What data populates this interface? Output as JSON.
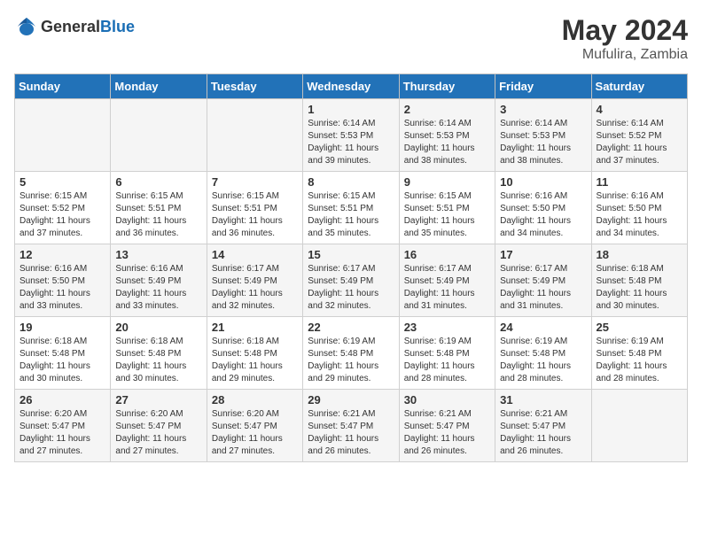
{
  "header": {
    "logo_general": "General",
    "logo_blue": "Blue",
    "month_year": "May 2024",
    "location": "Mufulira, Zambia"
  },
  "days_of_week": [
    "Sunday",
    "Monday",
    "Tuesday",
    "Wednesday",
    "Thursday",
    "Friday",
    "Saturday"
  ],
  "weeks": [
    [
      {
        "day": "",
        "info": ""
      },
      {
        "day": "",
        "info": ""
      },
      {
        "day": "",
        "info": ""
      },
      {
        "day": "1",
        "info": "Sunrise: 6:14 AM\nSunset: 5:53 PM\nDaylight: 11 hours\nand 39 minutes."
      },
      {
        "day": "2",
        "info": "Sunrise: 6:14 AM\nSunset: 5:53 PM\nDaylight: 11 hours\nand 38 minutes."
      },
      {
        "day": "3",
        "info": "Sunrise: 6:14 AM\nSunset: 5:53 PM\nDaylight: 11 hours\nand 38 minutes."
      },
      {
        "day": "4",
        "info": "Sunrise: 6:14 AM\nSunset: 5:52 PM\nDaylight: 11 hours\nand 37 minutes."
      }
    ],
    [
      {
        "day": "5",
        "info": "Sunrise: 6:15 AM\nSunset: 5:52 PM\nDaylight: 11 hours\nand 37 minutes."
      },
      {
        "day": "6",
        "info": "Sunrise: 6:15 AM\nSunset: 5:51 PM\nDaylight: 11 hours\nand 36 minutes."
      },
      {
        "day": "7",
        "info": "Sunrise: 6:15 AM\nSunset: 5:51 PM\nDaylight: 11 hours\nand 36 minutes."
      },
      {
        "day": "8",
        "info": "Sunrise: 6:15 AM\nSunset: 5:51 PM\nDaylight: 11 hours\nand 35 minutes."
      },
      {
        "day": "9",
        "info": "Sunrise: 6:15 AM\nSunset: 5:51 PM\nDaylight: 11 hours\nand 35 minutes."
      },
      {
        "day": "10",
        "info": "Sunrise: 6:16 AM\nSunset: 5:50 PM\nDaylight: 11 hours\nand 34 minutes."
      },
      {
        "day": "11",
        "info": "Sunrise: 6:16 AM\nSunset: 5:50 PM\nDaylight: 11 hours\nand 34 minutes."
      }
    ],
    [
      {
        "day": "12",
        "info": "Sunrise: 6:16 AM\nSunset: 5:50 PM\nDaylight: 11 hours\nand 33 minutes."
      },
      {
        "day": "13",
        "info": "Sunrise: 6:16 AM\nSunset: 5:49 PM\nDaylight: 11 hours\nand 33 minutes."
      },
      {
        "day": "14",
        "info": "Sunrise: 6:17 AM\nSunset: 5:49 PM\nDaylight: 11 hours\nand 32 minutes."
      },
      {
        "day": "15",
        "info": "Sunrise: 6:17 AM\nSunset: 5:49 PM\nDaylight: 11 hours\nand 32 minutes."
      },
      {
        "day": "16",
        "info": "Sunrise: 6:17 AM\nSunset: 5:49 PM\nDaylight: 11 hours\nand 31 minutes."
      },
      {
        "day": "17",
        "info": "Sunrise: 6:17 AM\nSunset: 5:49 PM\nDaylight: 11 hours\nand 31 minutes."
      },
      {
        "day": "18",
        "info": "Sunrise: 6:18 AM\nSunset: 5:48 PM\nDaylight: 11 hours\nand 30 minutes."
      }
    ],
    [
      {
        "day": "19",
        "info": "Sunrise: 6:18 AM\nSunset: 5:48 PM\nDaylight: 11 hours\nand 30 minutes."
      },
      {
        "day": "20",
        "info": "Sunrise: 6:18 AM\nSunset: 5:48 PM\nDaylight: 11 hours\nand 30 minutes."
      },
      {
        "day": "21",
        "info": "Sunrise: 6:18 AM\nSunset: 5:48 PM\nDaylight: 11 hours\nand 29 minutes."
      },
      {
        "day": "22",
        "info": "Sunrise: 6:19 AM\nSunset: 5:48 PM\nDaylight: 11 hours\nand 29 minutes."
      },
      {
        "day": "23",
        "info": "Sunrise: 6:19 AM\nSunset: 5:48 PM\nDaylight: 11 hours\nand 28 minutes."
      },
      {
        "day": "24",
        "info": "Sunrise: 6:19 AM\nSunset: 5:48 PM\nDaylight: 11 hours\nand 28 minutes."
      },
      {
        "day": "25",
        "info": "Sunrise: 6:19 AM\nSunset: 5:48 PM\nDaylight: 11 hours\nand 28 minutes."
      }
    ],
    [
      {
        "day": "26",
        "info": "Sunrise: 6:20 AM\nSunset: 5:47 PM\nDaylight: 11 hours\nand 27 minutes."
      },
      {
        "day": "27",
        "info": "Sunrise: 6:20 AM\nSunset: 5:47 PM\nDaylight: 11 hours\nand 27 minutes."
      },
      {
        "day": "28",
        "info": "Sunrise: 6:20 AM\nSunset: 5:47 PM\nDaylight: 11 hours\nand 27 minutes."
      },
      {
        "day": "29",
        "info": "Sunrise: 6:21 AM\nSunset: 5:47 PM\nDaylight: 11 hours\nand 26 minutes."
      },
      {
        "day": "30",
        "info": "Sunrise: 6:21 AM\nSunset: 5:47 PM\nDaylight: 11 hours\nand 26 minutes."
      },
      {
        "day": "31",
        "info": "Sunrise: 6:21 AM\nSunset: 5:47 PM\nDaylight: 11 hours\nand 26 minutes."
      },
      {
        "day": "",
        "info": ""
      }
    ]
  ]
}
